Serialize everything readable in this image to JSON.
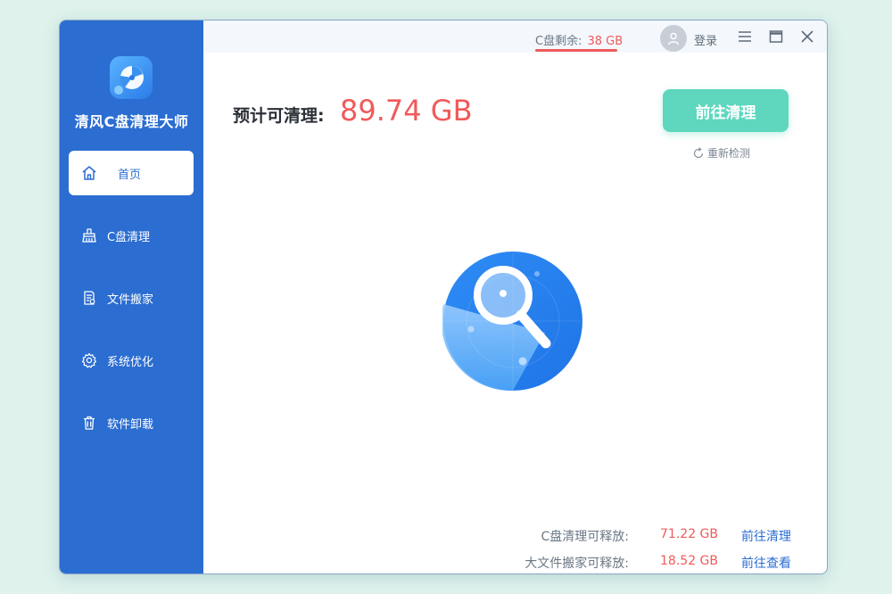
{
  "app": {
    "name": "清风C盘清理大师"
  },
  "sidebar": {
    "items": [
      {
        "label": "首页",
        "icon": "home-icon",
        "active": true
      },
      {
        "label": "C盘清理",
        "icon": "broom-icon",
        "active": false
      },
      {
        "label": "文件搬家",
        "icon": "file-move-icon",
        "active": false
      },
      {
        "label": "系统优化",
        "icon": "gear-icon",
        "active": false
      },
      {
        "label": "软件卸载",
        "icon": "trash-icon",
        "active": false
      }
    ]
  },
  "topbar": {
    "disk_label": "C盘剩余:",
    "disk_value": "38 GB",
    "login_label": "登录",
    "icons": [
      "menu-icon",
      "maximize-icon",
      "close-icon"
    ]
  },
  "main": {
    "estimate_label": "预计可清理:",
    "estimate_value": "89.74 GB",
    "clean_button": "前往清理",
    "recheck_label": "重新检测"
  },
  "stats": [
    {
      "label": "C盘清理可释放:",
      "value": "71.22 GB",
      "link": "前往清理"
    },
    {
      "label": "大文件搬家可释放:",
      "value": "18.52 GB",
      "link": "前往查看"
    }
  ],
  "colors": {
    "sidebar": "#2b6dd1",
    "accent_red": "#f05a5a",
    "button_green": "#5ed7be",
    "link_blue": "#2b6dd1",
    "background": "#dff3ec"
  }
}
